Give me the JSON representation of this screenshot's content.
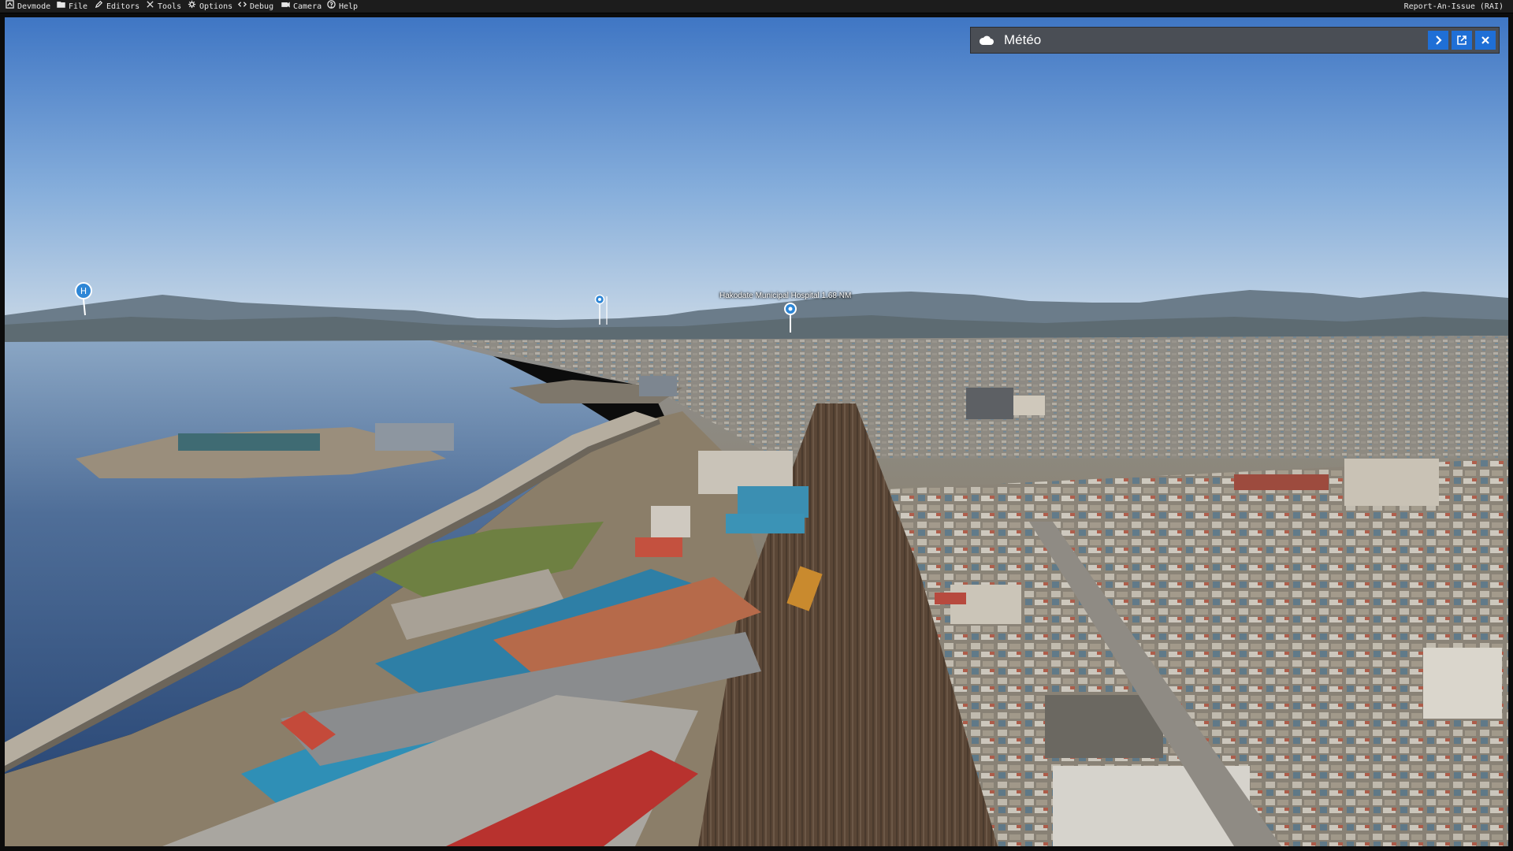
{
  "menubar": {
    "items": [
      {
        "label": "Devmode",
        "icon": "devmode-icon"
      },
      {
        "label": "File",
        "icon": "folder-icon"
      },
      {
        "label": "Editors",
        "icon": "pencil-icon"
      },
      {
        "label": "Tools",
        "icon": "tools-icon"
      },
      {
        "label": "Options",
        "icon": "gear-icon"
      },
      {
        "label": "Debug",
        "icon": "code-icon"
      },
      {
        "label": "Camera",
        "icon": "camera-icon"
      },
      {
        "label": "Help",
        "icon": "help-icon"
      }
    ],
    "report_label": "Report-An-Issue (RAI)"
  },
  "meteo_panel": {
    "title": "Météo",
    "icon": "cloud-icon",
    "buttons": [
      "chevron-right-icon",
      "popout-icon",
      "close-icon"
    ],
    "accent_color": "#1f6fd6"
  },
  "scene": {
    "description_markers": [
      {
        "icon": "helipad-icon"
      },
      {
        "icon": "poi-icon"
      },
      {
        "icon": "poi-icon",
        "label": "Hakodate Municipal Hospital  1.68  NM"
      }
    ]
  }
}
